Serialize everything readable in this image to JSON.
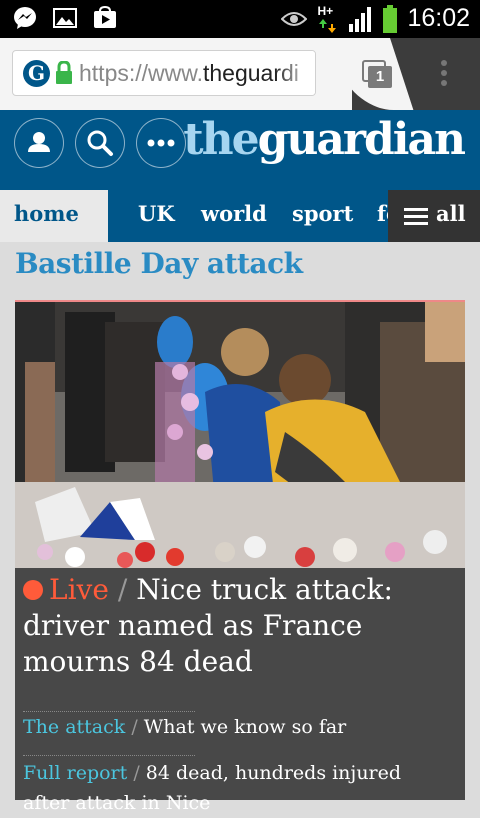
{
  "status_bar": {
    "time": "16:02",
    "network_label": "H+",
    "icons": [
      "messenger-icon",
      "gallery-icon",
      "play-store-icon",
      "eye-icon",
      "data-arrows-icon",
      "signal-icon",
      "battery-icon"
    ]
  },
  "browser": {
    "url_scheme": "https://www.",
    "url_domain": "theguardi",
    "tab_count": "1",
    "icons": [
      "guardian-favicon",
      "lock-icon",
      "tabs-icon",
      "overflow-menu-icon"
    ],
    "favicon_letter": "G"
  },
  "header": {
    "wordmark_the": "the",
    "wordmark_guardian": "guardian",
    "buttons": [
      "profile-icon",
      "search-icon",
      "more-icon"
    ],
    "brand_color": "#005689"
  },
  "nav": {
    "items": [
      "home",
      "UK",
      "world",
      "sport",
      "fo"
    ],
    "all_label": "all"
  },
  "section": {
    "title": "Bastille Day attack"
  },
  "story": {
    "live_label": "Live",
    "separator": "/",
    "headline": "Nice truck attack: driver named as France mourns 84 dead",
    "links": [
      {
        "kicker": "The attack",
        "text": "What we know so far"
      },
      {
        "kicker": "Full report",
        "text": "84 dead, hundreds injured after attack in Nice"
      }
    ]
  }
}
